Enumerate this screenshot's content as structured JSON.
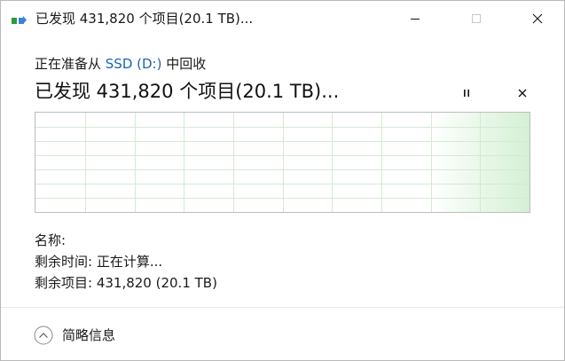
{
  "window": {
    "title": "已发现 431,820 个项目(20.1 TB)..."
  },
  "operation": {
    "prefix": "正在准备从 ",
    "source": "SSD (D:)",
    "suffix": " 中回收",
    "headline": "已发现 431,820 个项目(20.1 TB)..."
  },
  "details": {
    "name_label": "名称:",
    "time_remaining": "剩余时间: 正在计算...",
    "items_remaining": "剩余项目: 431,820 (20.1 TB)"
  },
  "footer": {
    "toggle_label": "简略信息"
  },
  "colors": {
    "accent_link": "#1a63b0",
    "graph_grid": "#cfe8cf",
    "graph_fill": "#d8f2d8"
  },
  "icons": {
    "app": "copy-files-icon",
    "minimize": "minimize-icon",
    "maximize": "maximize-icon",
    "close": "close-icon",
    "pause": "pause-icon",
    "cancel": "cancel-icon",
    "expand": "chevron-up-circle-icon"
  }
}
